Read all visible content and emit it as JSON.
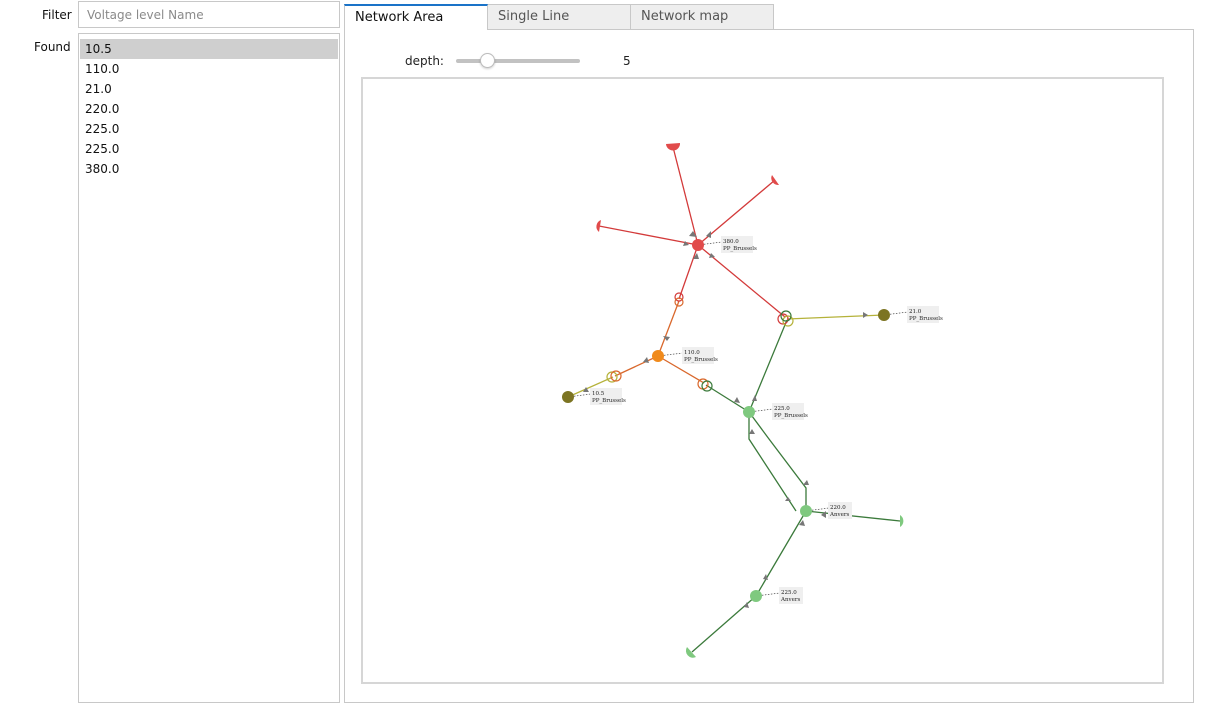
{
  "filter": {
    "label": "Filter",
    "placeholder": "Voltage level Name",
    "value": ""
  },
  "found": {
    "label": "Found",
    "items": [
      "10.5",
      "110.0",
      "21.0",
      "220.0",
      "225.0",
      "225.0",
      "380.0"
    ],
    "selected_index": 0
  },
  "tabs": [
    {
      "label": "Network Area",
      "active": true
    },
    {
      "label": "Single Line",
      "active": false
    },
    {
      "label": "Network map",
      "active": false
    }
  ],
  "depth": {
    "label": "depth:",
    "value": "5",
    "slider_fraction": 0.25
  },
  "colors": {
    "v380": "#e14b4b",
    "v110": "#f08a1c",
    "v225": "#7fc97f",
    "v21": "#7c7422",
    "line225": "#3b7a3b",
    "line110": "#d9682c",
    "line21": "#b5b23a"
  },
  "network": {
    "nodes": [
      {
        "id": "n380",
        "label1": "380.0",
        "label2": "PP_Brussels"
      },
      {
        "id": "n110",
        "label1": "110.0",
        "label2": "PP_Brussels"
      },
      {
        "id": "n10",
        "label1": "10.5",
        "label2": "PP_Brussels"
      },
      {
        "id": "n21",
        "label1": "21.0",
        "label2": "PP_Brussels"
      },
      {
        "id": "n225a",
        "label1": "225.0",
        "label2": "PP_Brussels"
      },
      {
        "id": "n220",
        "label1": "220.0",
        "label2": "Anvers"
      },
      {
        "id": "n225b",
        "label1": "225.0",
        "label2": "Anvers"
      }
    ]
  }
}
